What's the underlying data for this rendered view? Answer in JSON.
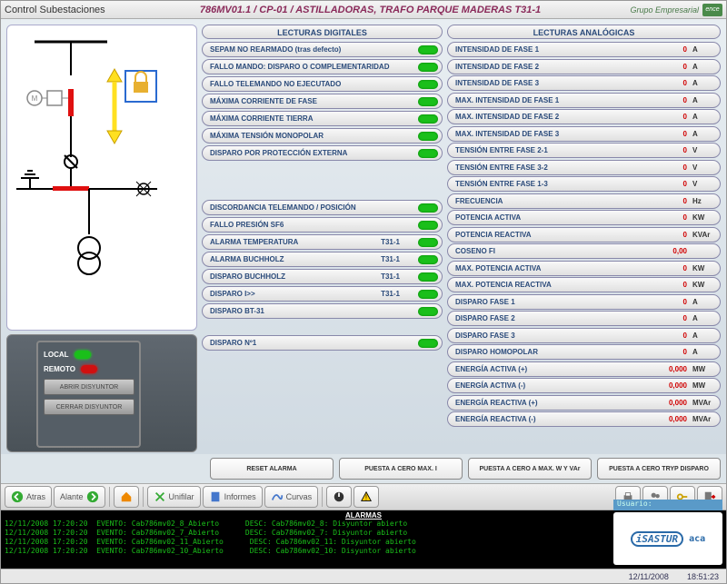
{
  "header": {
    "app": "Control Subestaciones",
    "title": "786MV01.1 / CP-01 / ASTILLADORAS, TRAFO PARQUE MADERAS T31-1",
    "group": "Grupo Empresarial",
    "logo": "ence"
  },
  "digital": {
    "title": "LECTURAS DIGITALES",
    "group1": [
      {
        "label": "SEPAM NO REARMADO (tras defecto)"
      },
      {
        "label": "FALLO MANDO: DISPARO O COMPLEMENTARIDAD"
      },
      {
        "label": "FALLO TELEMANDO NO EJECUTADO"
      },
      {
        "label": "MÁXIMA CORRIENTE DE FASE"
      },
      {
        "label": "MÁXIMA CORRIENTE TIERRA"
      },
      {
        "label": "MÁXIMA TENSIÓN MONOPOLAR"
      },
      {
        "label": "DISPARO POR PROTECCIÓN EXTERNA"
      }
    ],
    "group2": [
      {
        "label": "DISCORDANCIA TELEMANDO / POSICIÓN",
        "tag": ""
      },
      {
        "label": "FALLO PRESIÓN SF6",
        "tag": ""
      },
      {
        "label": "ALARMA TEMPERATURA",
        "tag": "T31-1"
      },
      {
        "label": "ALARMA BUCHHOLZ",
        "tag": "T31-1"
      },
      {
        "label": "DISPARO BUCHHOLZ",
        "tag": "T31-1"
      },
      {
        "label": "DISPARO I>>",
        "tag": "T31-1"
      },
      {
        "label": "DISPARO BT-31",
        "tag": ""
      }
    ],
    "group3": [
      {
        "label": "DISPARO Nº1"
      }
    ]
  },
  "analog": {
    "title": "LECTURAS ANALÓGICAS",
    "rows": [
      {
        "label": "INTENSIDAD DE FASE 1",
        "val": "0",
        "unit": "A"
      },
      {
        "label": "INTENSIDAD DE FASE 2",
        "val": "0",
        "unit": "A"
      },
      {
        "label": "INTENSIDAD DE FASE 3",
        "val": "0",
        "unit": "A"
      },
      {
        "label": "MAX. INTENSIDAD DE FASE 1",
        "val": "0",
        "unit": "A"
      },
      {
        "label": "MAX. INTENSIDAD DE FASE 2",
        "val": "0",
        "unit": "A"
      },
      {
        "label": "MAX. INTENSIDAD DE FASE 3",
        "val": "0",
        "unit": "A"
      },
      {
        "label": "TENSIÓN ENTRE FASE 2-1",
        "val": "0",
        "unit": "V"
      },
      {
        "label": "TENSIÓN ENTRE FASE 3-2",
        "val": "0",
        "unit": "V"
      },
      {
        "label": "TENSIÓN ENTRE FASE 1-3",
        "val": "0",
        "unit": "V"
      },
      {
        "label": "FRECUENCIA",
        "val": "0",
        "unit": "Hz"
      },
      {
        "label": "POTENCIA ACTIVA",
        "val": "0",
        "unit": "KW"
      },
      {
        "label": "POTENCIA REACTIVA",
        "val": "0",
        "unit": "KVAr"
      },
      {
        "label": "COSENO FI",
        "val": "0,00",
        "unit": ""
      },
      {
        "label": "MAX. POTENCIA ACTIVA",
        "val": "0",
        "unit": "KW"
      },
      {
        "label": "MAX. POTENCIA REACTIVA",
        "val": "0",
        "unit": "KW"
      },
      {
        "label": "DISPARO FASE 1",
        "val": "0",
        "unit": "A"
      },
      {
        "label": "DISPARO FASE 2",
        "val": "0",
        "unit": "A"
      },
      {
        "label": "DISPARO FASE 3",
        "val": "0",
        "unit": "A"
      },
      {
        "label": "DISPARO HOMOPOLAR",
        "val": "0",
        "unit": "A"
      },
      {
        "label": "ENERGÍA ACTIVA (+)",
        "val": "0,000",
        "unit": "MW"
      },
      {
        "label": "ENERGÍA ACTIVA (-)",
        "val": "0,000",
        "unit": "MW"
      },
      {
        "label": "ENERGÍA REACTIVA (+)",
        "val": "0,000",
        "unit": "MVAr"
      },
      {
        "label": "ENERGÍA REACTIVA (-)",
        "val": "0,000",
        "unit": "MVAr"
      }
    ]
  },
  "control": {
    "local": "LOCAL",
    "remoto": "REMOTO",
    "btn1": "ABRIR DISYUNTOR",
    "btn2": "CERRAR DISYUNTOR"
  },
  "actions": {
    "b1": "RESET ALARMA",
    "b2": "PUESTA A CERO MAX. I",
    "b3": "PUESTA A CERO A MAX. W Y VAr",
    "b4": "PUESTA A CERO TRYP DISPARO"
  },
  "toolbar": {
    "atras": "Atras",
    "alante": "Alante",
    "unifilar": "Unifilar",
    "informes": "Informes",
    "curvas": "Curvas"
  },
  "alarms": {
    "title": "ALARMAS",
    "usuario": "Usuario:",
    "lines": [
      {
        "ts": "12/11/2008 17:20:20",
        "ev": "EVENTO: Cab786mv02_8_Abierto",
        "desc": "DESC: Cab786mv02_8: Disyuntor abierto"
      },
      {
        "ts": "12/11/2008 17:20:20",
        "ev": "EVENTO: Cab786mv02_7_Abierto",
        "desc": "DESC: Cab786mv02_7: Disyuntor abierto"
      },
      {
        "ts": "12/11/2008 17:20:20",
        "ev": "EVENTO: Cab786mv02_11_Abierto",
        "desc": "DESC: Cab786mv02_11: Disyuntor abierto"
      },
      {
        "ts": "12/11/2008 17:20:20",
        "ev": "EVENTO: Cab786mv02_10_Abierto",
        "desc": "DESC: Cab786mv02_10: Disyuntor abierto"
      }
    ],
    "logo": "iSASTUR",
    "logo2": "aca"
  },
  "status": {
    "date": "12/11/2008",
    "time": "18:51:23"
  }
}
